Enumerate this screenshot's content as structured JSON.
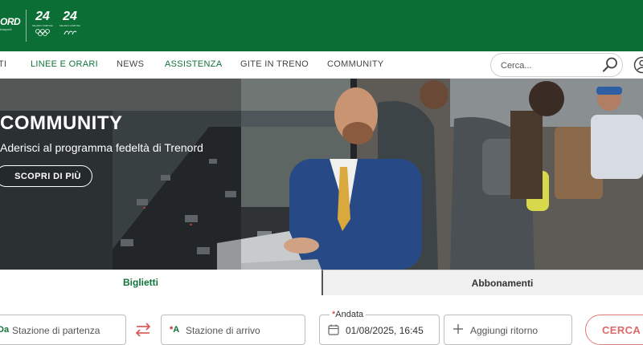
{
  "header": {
    "logo_text": "ORD",
    "logo_sub": "trasporti",
    "olympic_mark_1": "24",
    "olympic_mark_2": "24",
    "colors": {
      "brand_green": "#0b6e35",
      "accent_red": "#d96a6a"
    }
  },
  "nav": {
    "items": [
      {
        "label": "TI",
        "style": "default"
      },
      {
        "label": "LINEE E ORARI",
        "style": "green"
      },
      {
        "label": "NEWS",
        "style": "default"
      },
      {
        "label": "ASSISTENZA",
        "style": "green"
      },
      {
        "label": "GITE IN TRENO",
        "style": "default"
      },
      {
        "label": "COMMUNITY",
        "style": "default"
      }
    ],
    "search_placeholder": "Cerca...",
    "icons": [
      "search-icon",
      "user-icon"
    ]
  },
  "hero": {
    "title": "COMMUNITY",
    "subtitle": "Aderisci al programma fedeltà di Trenord",
    "cta_label": "SCOPRI DI PIÙ"
  },
  "tabs": [
    {
      "label": "Biglietti",
      "active": true
    },
    {
      "label": "Abbonamenti",
      "active": false
    }
  ],
  "form": {
    "from_prefix": "Da",
    "from_placeholder": "Stazione di partenza",
    "to_prefix": "A",
    "to_placeholder": "Stazione di arrivo",
    "departure_label": "Andata",
    "departure_value": "01/08/2025, 16:45",
    "return_placeholder": "Aggiungi ritorno",
    "submit_label": "CERCA",
    "icons": [
      "swap-icon",
      "calendar-icon",
      "plus-icon"
    ]
  }
}
